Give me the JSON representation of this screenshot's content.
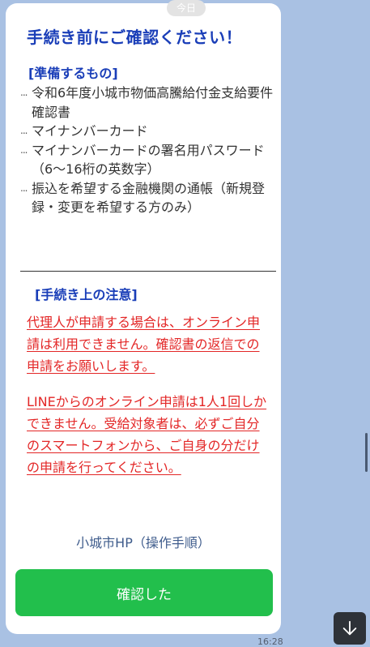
{
  "date_separator": "今日",
  "card": {
    "title": "手続き前にご確認ください！",
    "prep_heading": "[準備するもの]",
    "prep_items": [
      {
        "bullet": "...",
        "text": "令和6年度小城市物価高騰給付金支給要件確認書"
      },
      {
        "bullet": "...",
        "text": "マイナンバーカード"
      },
      {
        "bullet": "...",
        "text": "マイナンバーカードの署名用パスワード（6〜16桁の英数字）"
      },
      {
        "bullet": "...",
        "text": "振込を希望する金融機関の通帳（新規登録・変更を希望する方のみ）"
      }
    ],
    "notes_heading": "[手続き上の注意]",
    "warnings": [
      "代理人が申請する場合は、オンライン申請は利用できません。確認書の返信での申請をお願いします。",
      "LINEからのオンライン申請は1人1回しかできません。受給対象者は、必ずご自分のスマートフォンから、ご自身の分だけの申請を行ってください。"
    ],
    "hp_link": "小城市HP（操作手順）",
    "confirm_button": "確認した"
  },
  "timestamp": "16:28",
  "icons": {
    "scroll_down": "arrow-down-icon"
  },
  "colors": {
    "background": "#a9c1e3",
    "heading_blue": "#1a3eb8",
    "warning_red": "#e32626",
    "button_green": "#22bf4c",
    "link": "#3f5c8c"
  }
}
